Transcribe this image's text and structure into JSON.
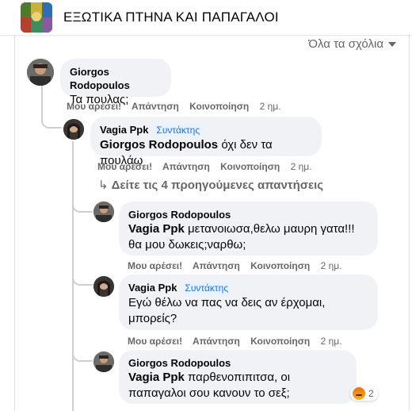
{
  "header": {
    "group_title": "ΕΞΩΤΙΚΑ ΠΤΗΝΑ ΚΑΙ ΠΑΠΑΓΑΛΟΙ"
  },
  "sort_label": "Όλα τα σχόλια",
  "colors": {
    "bubble": "#f0f2f5",
    "badge_text": "#1b74e4",
    "badge_bg": "#e7f3ff",
    "meta": "#65676b"
  },
  "comments": [
    {
      "author": "Giorgos Rodopoulos",
      "text": "Τα πουλας;",
      "actions": {
        "like": "Μου αρέσει!",
        "reply": "Απάντηση",
        "share": "Κοινοποίηση",
        "time": "2 ημ."
      }
    },
    {
      "author": "Vagia Ppk",
      "badge": "Συντάκτης",
      "mention": "Giorgos Rodopoulos",
      "text": " όχι δεν τα πουλάω",
      "actions": {
        "like": "Μου αρέσει!",
        "reply": "Απάντηση",
        "share": "Κοινοποίηση",
        "time": "2 ημ."
      }
    },
    {
      "author": "Giorgos Rodopoulos",
      "mention": "Vagia Ppk",
      "text_line1": " μετανοιωσα,θελω μαυρη γατα!!!",
      "text_line2": "θα μου δωκεις;ναρθω;",
      "actions": {
        "like": "Μου αρέσει!",
        "reply": "Απάντηση",
        "share": "Κοινοποίηση",
        "time": "2 ημ."
      }
    },
    {
      "author": "Vagia Ppk",
      "badge": "Συντάκτης",
      "text_line1": "Εγώ θέλω να πας να δεις αν έρχομαι,",
      "text_line2": "μπορείς?",
      "actions": {
        "like": "Μου αρέσει!",
        "reply": "Απάντηση",
        "share": "Κοινοποίηση",
        "time": "2 ημ."
      }
    },
    {
      "author": "Giorgos Rodopoulos",
      "mention": "Vagia Ppk",
      "text_line1": " παρθενοπιπιτσα, οι",
      "text_line2": "παπαγαλοι σου κανουν το σεξ;",
      "reaction": {
        "icon": "angry-reaction-icon",
        "count": "2"
      }
    }
  ],
  "more_replies": "Δείτε τις 4 προηγούμενες απαντήσεις"
}
